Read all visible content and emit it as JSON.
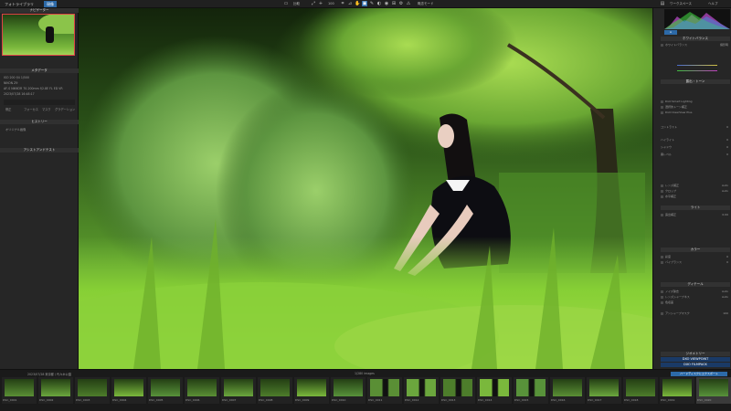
{
  "topbar": {
    "tabs": [
      "フォトライブラリ",
      "現像"
    ],
    "center_items": [
      "比較",
      "100"
    ],
    "right_items": [
      "概念モード",
      "ワークスペース",
      "ヘルプ"
    ]
  },
  "left_panel": {
    "nav_title": "ナビゲーター",
    "meta_title": "メタデータ",
    "meta_rows": [
      "ISO 200   f/4   1/500",
      "NIKON Z9",
      "AF-S NIKKOR 70-200mm f/2.8E FL ED VR",
      "2023/07/28 16:48:17"
    ],
    "tool_labels": [
      "修正",
      "フォーカス",
      "マスク",
      "グラデーション"
    ],
    "history_title": "ヒストリー",
    "history_item": "オリジナル画像",
    "bottom_title": "アシストアンドテスト"
  },
  "right_panel": {
    "sections": [
      "ホワイトバランス",
      "露出・トーン",
      "ライト",
      "カラー",
      "ディテール",
      "ジオメトリー"
    ],
    "rows": [
      [
        "ホワイトバランス",
        "撮影時"
      ],
      [
        "DxO Smart Lighting",
        ""
      ],
      [
        "選択的トーン補正",
        ""
      ],
      [
        "DxO ClearView Plus",
        ""
      ],
      [
        "コントラスト",
        "0"
      ],
      [
        "ハイライト",
        "0"
      ],
      [
        "シャドウ",
        "0"
      ],
      [
        "黒レベル",
        "0"
      ],
      [
        "レンズ補正",
        "Auto"
      ],
      [
        "クロップ",
        "Auto"
      ],
      [
        "水平補正",
        ""
      ],
      [
        "露出補正",
        "0.00"
      ],
      [
        "彩度",
        "0"
      ],
      [
        "バイブランス",
        "0"
      ],
      [
        "ノイズ除去",
        "Auto"
      ],
      [
        "レンズシャープネス",
        "Auto"
      ],
      [
        "色収差",
        ""
      ],
      [
        "アンシャープマスク",
        "100"
      ]
    ],
    "bottom_buttons": [
      "DXO VIEWPOINT",
      "DXO FILMPACK"
    ],
    "export_label": "エクスポート"
  },
  "filmstrip": {
    "folder": "2023/07/28 東京都 / 代々木公園",
    "count": "1/280 images",
    "export_button": "ハードディスクにエクスポート",
    "captions": [
      "DSC_0001",
      "DSC_0002",
      "DSC_0003",
      "DSC_0004",
      "DSC_0005",
      "DSC_0006",
      "DSC_0007",
      "DSC_0008",
      "DSC_0009",
      "DSC_0010",
      "DSC_0011",
      "DSC_0012",
      "DSC_0013",
      "DSC_0014",
      "DSC_0015",
      "DSC_0016",
      "DSC_0017",
      "DSC_0018",
      "DSC_0019",
      "DSC_0020"
    ]
  }
}
